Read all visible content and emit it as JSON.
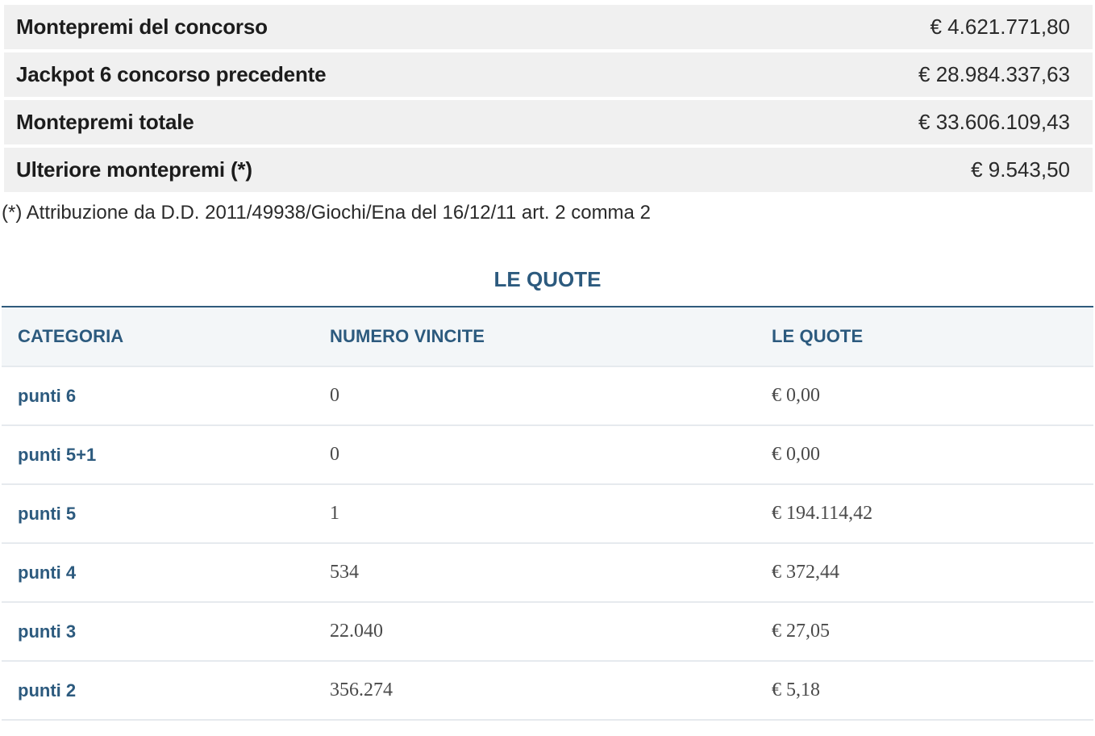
{
  "summary": {
    "rows": [
      {
        "label": "Montepremi del concorso",
        "value": "€ 4.621.771,80"
      },
      {
        "label": "Jackpot 6 concorso precedente",
        "value": "€ 28.984.337,63"
      },
      {
        "label": "Montepremi totale",
        "value": "€ 33.606.109,43"
      },
      {
        "label": "Ulteriore montepremi (*)",
        "value": "€ 9.543,50"
      }
    ],
    "footnote": "(*) Attribuzione da D.D. 2011/49938/Giochi/Ena del 16/12/11 art. 2 comma 2"
  },
  "quotes": {
    "title": "LE QUOTE",
    "headers": {
      "category": "CATEGORIA",
      "wins": "NUMERO VINCITE",
      "quote": "LE QUOTE"
    },
    "rows": [
      {
        "category": "punti 6",
        "wins": "0",
        "quote": "€ 0,00"
      },
      {
        "category": "punti 5+1",
        "wins": "0",
        "quote": "€ 0,00"
      },
      {
        "category": "punti 5",
        "wins": "1",
        "quote": "€ 194.114,42"
      },
      {
        "category": "punti 4",
        "wins": "534",
        "quote": "€ 372,44"
      },
      {
        "category": "punti 3",
        "wins": "22.040",
        "quote": "€ 27,05"
      },
      {
        "category": "punti 2",
        "wins": "356.274",
        "quote": "€ 5,18"
      }
    ]
  },
  "colors": {
    "accent": "#2c5a7e",
    "row_background": "#f0f0f0",
    "header_background": "#f3f6f8"
  }
}
